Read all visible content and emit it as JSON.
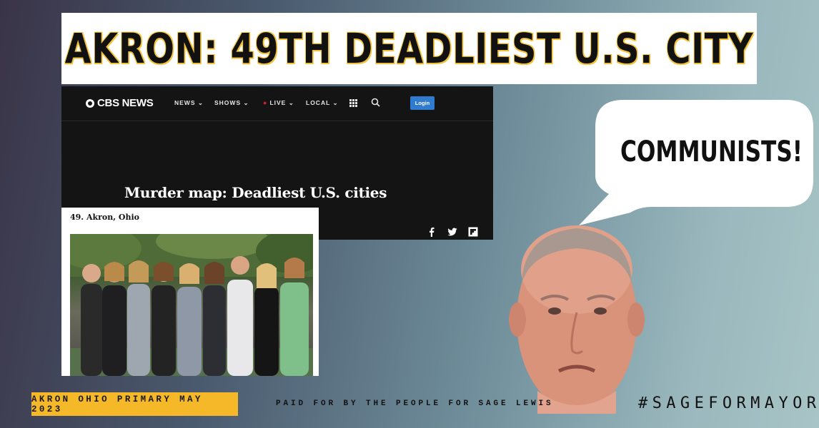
{
  "headline": "AKRON: 49TH DEADLIEST U.S. CITY",
  "cbs": {
    "logo": "CBS NEWS",
    "nav": {
      "news": "NEWS",
      "shows": "SHOWS",
      "live": "LIVE",
      "local": "LOCAL"
    },
    "login_label": "Login",
    "article_title": "Murder map: Deadliest U.S. cities",
    "login_color": "#2f7bd0"
  },
  "snippet": {
    "label": "49. Akron, Ohio"
  },
  "bubble": {
    "text": "COMMUNISTS!"
  },
  "footer": {
    "primary": "AKRON OHIO PRIMARY MAY 2023",
    "paid_for": "PAID FOR BY THE PEOPLE FOR SAGE LEWIS",
    "hashtag": "#SAGEFORMAYOR"
  },
  "colors": {
    "accent_yellow": "#f5b829",
    "headline_glow": "#f2c23a"
  }
}
